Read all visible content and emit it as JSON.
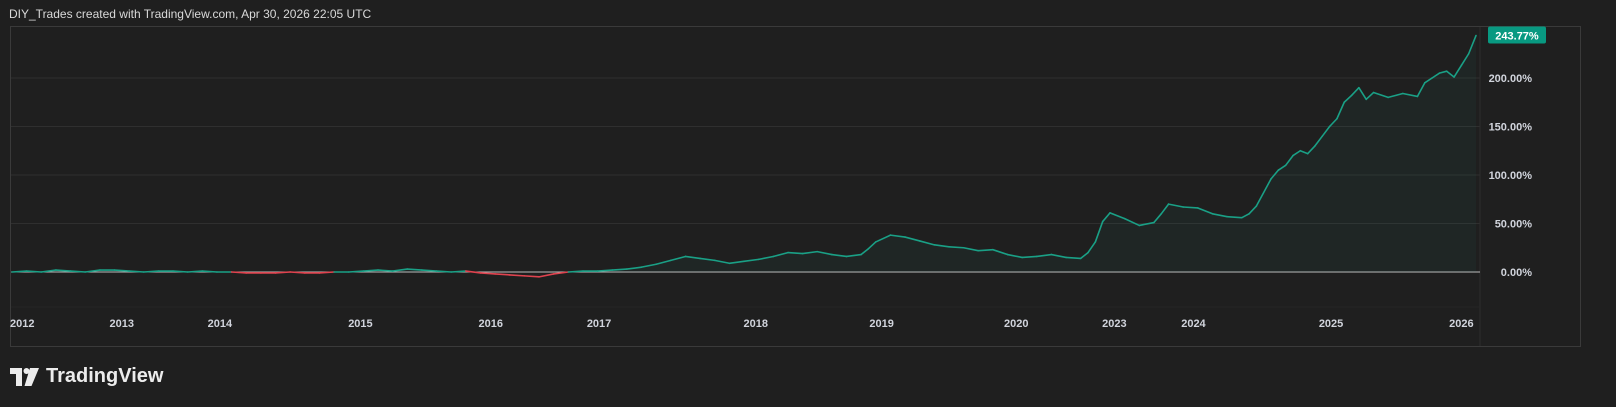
{
  "header": {
    "attribution": "DIY_Trades created with TradingView.com, Apr 30, 2026 22:05 UTC"
  },
  "footer": {
    "brand_name": "TradingView",
    "logo_icon": "tradingview-logo-icon"
  },
  "colors": {
    "background": "#1f1f1f",
    "grid": "#2f2f2f",
    "up": "#1aa086",
    "down": "#e0434f",
    "zero_line": "#bdbdbd",
    "axis_text": "#d1d4dc",
    "badge_bg": "#089981",
    "badge_text": "#ffffff"
  },
  "chart_data": {
    "type": "area",
    "y_unit": "%",
    "ylim": [
      -10,
      260
    ],
    "y_ticks": [
      "200.00%",
      "150.00%",
      "100.00%",
      "50.00%",
      "0.00%"
    ],
    "y_tick_values": [
      200,
      150,
      100,
      50,
      0
    ],
    "x_ticks": [
      "2012",
      "2013",
      "2014",
      "2015",
      "2016",
      "2017",
      "2018",
      "2019",
      "2020",
      "2023",
      "2024",
      "2025",
      "2026"
    ],
    "x_tick_positions": [
      0.0,
      0.075,
      0.142,
      0.238,
      0.327,
      0.401,
      0.508,
      0.594,
      0.686,
      0.753,
      0.807,
      0.901,
      0.99
    ],
    "last_value_label": "243.77%",
    "last_value": 243.77,
    "grid": true,
    "series": [
      {
        "x": [
          0.0,
          0.01,
          0.02,
          0.03,
          0.04,
          0.05,
          0.06,
          0.07,
          0.08,
          0.09,
          0.1,
          0.11,
          0.12,
          0.13,
          0.14,
          0.15,
          0.16,
          0.17,
          0.18,
          0.19,
          0.2,
          0.21,
          0.22,
          0.23,
          0.24,
          0.25,
          0.26,
          0.27,
          0.28,
          0.29,
          0.3,
          0.31,
          0.32,
          0.33,
          0.34,
          0.35,
          0.36,
          0.37,
          0.38,
          0.39,
          0.4,
          0.41,
          0.42,
          0.43,
          0.44,
          0.45,
          0.46,
          0.47,
          0.48,
          0.49,
          0.5,
          0.51,
          0.52,
          0.53,
          0.54,
          0.55,
          0.56,
          0.57,
          0.58,
          0.585,
          0.59,
          0.6,
          0.61,
          0.62,
          0.63,
          0.64,
          0.65,
          0.66,
          0.67,
          0.68,
          0.69,
          0.7,
          0.71,
          0.72,
          0.73,
          0.735,
          0.74,
          0.745,
          0.75,
          0.76,
          0.77,
          0.78,
          0.785,
          0.79,
          0.8,
          0.81,
          0.82,
          0.83,
          0.84,
          0.845,
          0.85,
          0.86,
          0.865,
          0.87,
          0.875,
          0.88,
          0.885,
          0.89,
          0.895,
          0.9,
          0.905,
          0.91,
          0.915,
          0.92,
          0.925,
          0.93,
          0.94,
          0.95,
          0.96,
          0.965,
          0.97,
          0.975,
          0.98,
          0.985,
          0.99,
          0.995,
          1.0
        ],
        "y": [
          0,
          1,
          0,
          2,
          1,
          0,
          2,
          2,
          1,
          0,
          1,
          1,
          0,
          1,
          0,
          0,
          -1,
          -1,
          -1,
          0,
          -1,
          -1,
          0,
          0,
          1,
          2,
          1,
          3,
          2,
          1,
          0,
          1,
          -1,
          -2,
          -3,
          -4,
          -5,
          -2,
          0,
          1,
          1,
          2,
          3,
          5,
          8,
          12,
          16,
          14,
          12,
          9,
          11,
          13,
          16,
          20,
          19,
          21,
          18,
          16,
          18,
          24,
          31,
          38,
          36,
          32,
          28,
          26,
          25,
          22,
          23,
          18,
          15,
          16,
          18,
          15,
          14,
          20,
          31,
          52,
          61,
          55,
          48,
          51,
          60,
          70,
          67,
          66,
          60,
          57,
          56,
          60,
          68,
          96,
          105,
          110,
          120,
          125,
          122,
          130,
          140,
          150,
          158,
          175,
          182,
          190,
          178,
          185,
          180,
          184,
          181,
          195,
          200,
          205,
          207,
          201,
          213,
          225,
          243.77
        ]
      }
    ]
  }
}
